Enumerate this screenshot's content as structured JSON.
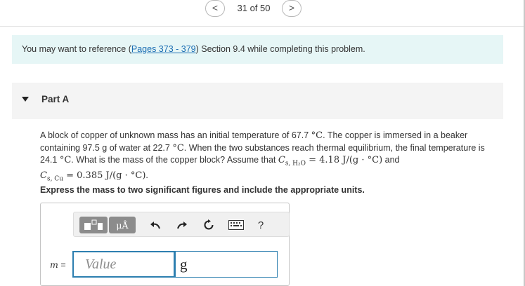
{
  "pager": {
    "prev_icon": "chevron-left-icon",
    "next_icon": "chevron-right-icon",
    "count": "31 of 50"
  },
  "reference": {
    "prefix": "You may want to reference (",
    "link": "Pages 373 - 379",
    "suffix": ") Section 9.4 while completing this problem."
  },
  "part": {
    "title": "Part A",
    "expand_icon": "triangle-down-icon"
  },
  "problem": {
    "t1": "A block of copper of unknown mass has an initial temperature of 67.7 ",
    "deg1": "°C",
    "t2": ". The copper is immersed in a beaker containing 97.5 g of water at 22.7 ",
    "deg2": "°C",
    "t3": ". When the two substances reach thermal equilibrium, the final temperature is 24.1 ",
    "deg3": "°C",
    "t4": ". What is the mass of the copper block? Assume that ",
    "cs_water": "C",
    "cs_water_sub": "s, H₂O",
    "eq_water": " = 4.18 J/(g · °C)",
    "and": " and",
    "cs_cu": "C",
    "cs_cu_sub": "s, Cu",
    "eq_cu": " = 0.385 J/(g · °C)",
    "end": "."
  },
  "instruction": "Express the mass to two significant figures and include the appropriate units.",
  "toolbar": {
    "template_icon": "template-icon",
    "units_label": "μÅ",
    "undo_icon": "undo-icon",
    "redo_icon": "redo-icon",
    "reset_icon": "reset-icon",
    "keyboard_icon": "keyboard-icon",
    "help_label": "?"
  },
  "answer": {
    "variable": "m",
    "equals": " =",
    "value_placeholder": "Value",
    "value": "",
    "units": "g"
  },
  "colors": {
    "banner": "#e6f6f6",
    "link": "#1a6db3",
    "input_border": "#2d7fb0",
    "toolbar_btn": "#8c8c8c"
  }
}
